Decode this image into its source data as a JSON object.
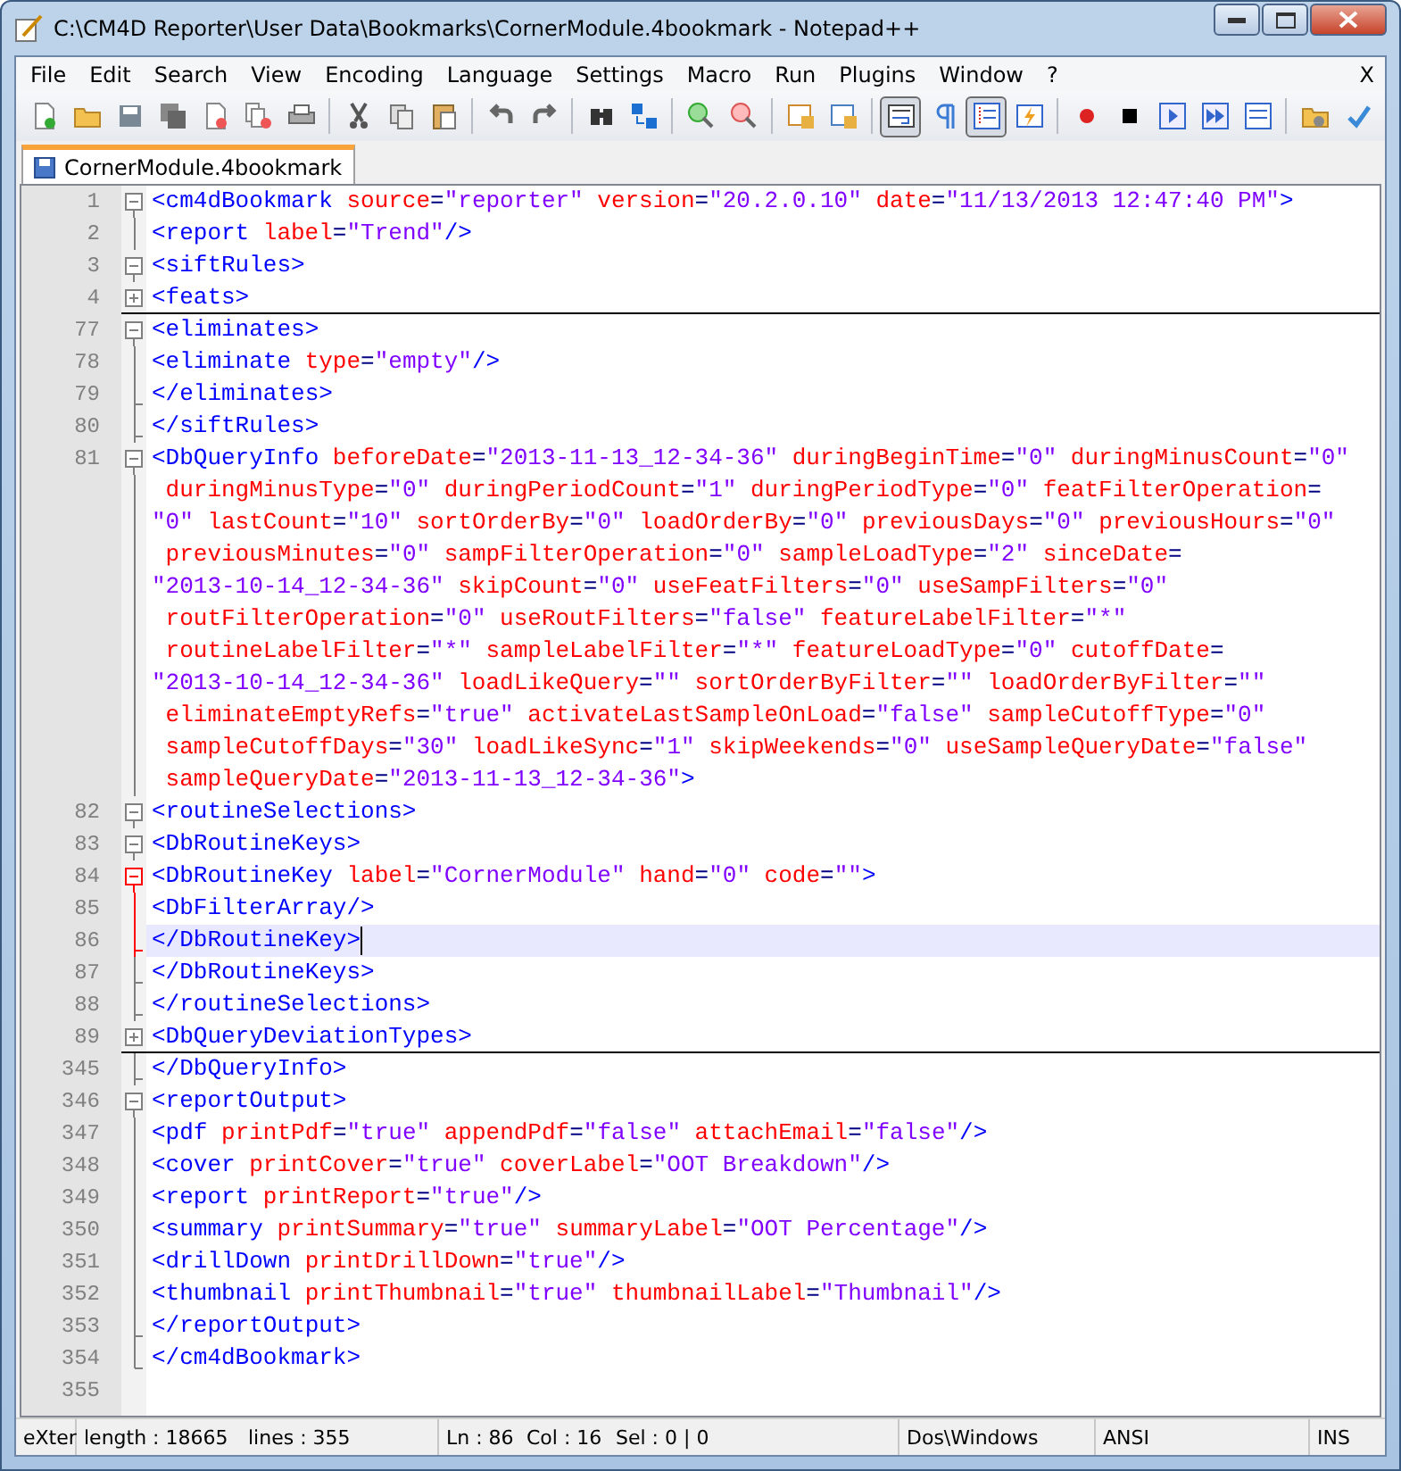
{
  "window": {
    "title": "C:\\CM4D Reporter\\User Data\\Bookmarks\\CornerModule.4bookmark - Notepad++"
  },
  "menu": [
    "File",
    "Edit",
    "Search",
    "View",
    "Encoding",
    "Language",
    "Settings",
    "Macro",
    "Run",
    "Plugins",
    "Window",
    "?"
  ],
  "menu_close": "X",
  "toolbar": {
    "view_toggles": [
      {
        "pressed": true
      },
      {
        "pressed": false
      },
      {
        "pressed": true
      },
      {
        "pressed": false
      }
    ]
  },
  "tabs": [
    {
      "label": "CornerModule.4bookmark",
      "selected": true
    }
  ],
  "lines": [
    {
      "number": "1",
      "kind": "start",
      "fold_active": false,
      "current": false,
      "rows": [
        {
          "tokens": [
            {
              "kind": "tag",
              "text": "<cm4dBookmark"
            },
            {
              "kind": "attr",
              "name": "source",
              "eq": "=",
              "value": "\"reporter\""
            },
            {
              "kind": "attr",
              "name": "version",
              "eq": "=",
              "value": "\"20.2.0.10\""
            },
            {
              "kind": "attr",
              "name": "date",
              "eq": "=",
              "value": "\"11/13/2013 12:47:40 PM\""
            },
            {
              "kind": "tag",
              "text": ">"
            }
          ]
        }
      ]
    },
    {
      "number": "2",
      "kind": "body",
      "fold_active": false,
      "current": false,
      "rows": [
        {
          "tokens": [
            {
              "kind": "tag",
              "text": "<report"
            },
            {
              "kind": "attr",
              "name": "label",
              "eq": "=",
              "value": "\"Trend\""
            },
            {
              "kind": "tag",
              "text": "/>"
            }
          ]
        }
      ]
    },
    {
      "number": "3",
      "kind": "start",
      "fold_active": false,
      "current": false,
      "rows": [
        {
          "tokens": [
            {
              "kind": "tag",
              "text": "<siftRules>"
            }
          ]
        }
      ]
    },
    {
      "number": "4",
      "kind": "folded",
      "fold_active": false,
      "current": false,
      "rows": [
        {
          "tokens": [
            {
              "kind": "tag",
              "text": "<feats>"
            }
          ]
        }
      ]
    },
    {
      "number": "77",
      "kind": "start",
      "fold_active": false,
      "current": false,
      "rows": [
        {
          "tokens": [
            {
              "kind": "tag",
              "text": "<eliminates>"
            }
          ]
        }
      ]
    },
    {
      "number": "78",
      "kind": "body",
      "fold_active": false,
      "current": false,
      "rows": [
        {
          "tokens": [
            {
              "kind": "tag",
              "text": "<eliminate"
            },
            {
              "kind": "attr",
              "name": "type",
              "eq": "=",
              "value": "\"empty\""
            },
            {
              "kind": "tag",
              "text": "/>"
            }
          ]
        }
      ]
    },
    {
      "number": "79",
      "kind": "end",
      "fold_active": false,
      "current": false,
      "rows": [
        {
          "tokens": [
            {
              "kind": "tag",
              "text": "</eliminates>"
            }
          ]
        }
      ]
    },
    {
      "number": "80",
      "kind": "end",
      "fold_active": false,
      "current": false,
      "rows": [
        {
          "tokens": [
            {
              "kind": "tag",
              "text": "</siftRules>"
            }
          ]
        }
      ]
    },
    {
      "number": "81",
      "kind": "start",
      "fold_active": false,
      "current": false,
      "rows": [
        {
          "tokens": [
            {
              "kind": "tag",
              "text": "<DbQueryInfo"
            },
            {
              "kind": "attr",
              "name": "beforeDate",
              "eq": "=",
              "value": "\"2013-11-13_12-34-36\""
            },
            {
              "kind": "attr",
              "name": "duringBeginTime",
              "eq": "=",
              "value": "\"0\""
            },
            {
              "kind": "attr",
              "name": "duringMinusCount",
              "eq": "=",
              "value": "\"0\""
            }
          ]
        },
        {
          "tokens": [
            {
              "kind": "attr",
              "name": "duringMinusType",
              "eq": "=",
              "value": "\"0\""
            },
            {
              "kind": "attr",
              "name": "duringPeriodCount",
              "eq": "=",
              "value": "\"1\""
            },
            {
              "kind": "attr",
              "name": "duringPeriodType",
              "eq": "=",
              "value": "\"0\""
            },
            {
              "kind": "attr",
              "name": "featFilterOperation",
              "eq": "="
            }
          ]
        },
        {
          "tokens": [
            {
              "kind": "value",
              "text": "\"0\""
            },
            {
              "kind": "attr",
              "name": "lastCount",
              "eq": "=",
              "value": "\"10\""
            },
            {
              "kind": "attr",
              "name": "sortOrderBy",
              "eq": "=",
              "value": "\"0\""
            },
            {
              "kind": "attr",
              "name": "loadOrderBy",
              "eq": "=",
              "value": "\"0\""
            },
            {
              "kind": "attr",
              "name": "previousDays",
              "eq": "=",
              "value": "\"0\""
            },
            {
              "kind": "attr",
              "name": "previousHours",
              "eq": "=",
              "value": "\"0\""
            }
          ]
        },
        {
          "tokens": [
            {
              "kind": "attr",
              "name": "previousMinutes",
              "eq": "=",
              "value": "\"0\""
            },
            {
              "kind": "attr",
              "name": "sampFilterOperation",
              "eq": "=",
              "value": "\"0\""
            },
            {
              "kind": "attr",
              "name": "sampleLoadType",
              "eq": "=",
              "value": "\"2\""
            },
            {
              "kind": "attr",
              "name": "sinceDate",
              "eq": "="
            }
          ]
        },
        {
          "tokens": [
            {
              "kind": "value",
              "text": "\"2013-10-14_12-34-36\""
            },
            {
              "kind": "attr",
              "name": "skipCount",
              "eq": "=",
              "value": "\"0\""
            },
            {
              "kind": "attr",
              "name": "useFeatFilters",
              "eq": "=",
              "value": "\"0\""
            },
            {
              "kind": "attr",
              "name": "useSampFilters",
              "eq": "=",
              "value": "\"0\""
            }
          ]
        },
        {
          "tokens": [
            {
              "kind": "attr",
              "name": "routFilterOperation",
              "eq": "=",
              "value": "\"0\""
            },
            {
              "kind": "attr",
              "name": "useRoutFilters",
              "eq": "=",
              "value": "\"false\""
            },
            {
              "kind": "attr",
              "name": "featureLabelFilter",
              "eq": "=",
              "value": "\"*\""
            }
          ]
        },
        {
          "tokens": [
            {
              "kind": "attr",
              "name": "routineLabelFilter",
              "eq": "=",
              "value": "\"*\""
            },
            {
              "kind": "attr",
              "name": "sampleLabelFilter",
              "eq": "=",
              "value": "\"*\""
            },
            {
              "kind": "attr",
              "name": "featureLoadType",
              "eq": "=",
              "value": "\"0\""
            },
            {
              "kind": "attr",
              "name": "cutoffDate",
              "eq": "="
            }
          ]
        },
        {
          "tokens": [
            {
              "kind": "value",
              "text": "\"2013-10-14_12-34-36\""
            },
            {
              "kind": "attr",
              "name": "loadLikeQuery",
              "eq": "=",
              "value": "\"\""
            },
            {
              "kind": "attr",
              "name": "sortOrderByFilter",
              "eq": "=",
              "value": "\"\""
            },
            {
              "kind": "attr",
              "name": "loadOrderByFilter",
              "eq": "=",
              "value": "\"\""
            }
          ]
        },
        {
          "tokens": [
            {
              "kind": "attr",
              "name": "eliminateEmptyRefs",
              "eq": "=",
              "value": "\"true\""
            },
            {
              "kind": "attr",
              "name": "activateLastSampleOnLoad",
              "eq": "=",
              "value": "\"false\""
            },
            {
              "kind": "attr",
              "name": "sampleCutoffType",
              "eq": "=",
              "value": "\"0\""
            }
          ]
        },
        {
          "tokens": [
            {
              "kind": "attr",
              "name": "sampleCutoffDays",
              "eq": "=",
              "value": "\"30\""
            },
            {
              "kind": "attr",
              "name": "loadLikeSync",
              "eq": "=",
              "value": "\"1\""
            },
            {
              "kind": "attr",
              "name": "skipWeekends",
              "eq": "=",
              "value": "\"0\""
            },
            {
              "kind": "attr",
              "name": "useSampleQueryDate",
              "eq": "=",
              "value": "\"false\""
            }
          ]
        },
        {
          "tokens": [
            {
              "kind": "attr",
              "name": "sampleQueryDate",
              "eq": "=",
              "value": "\"2013-11-13_12-34-36\""
            },
            {
              "kind": "tag",
              "text": ">"
            }
          ]
        }
      ]
    },
    {
      "number": "82",
      "kind": "start",
      "fold_active": false,
      "current": false,
      "rows": [
        {
          "tokens": [
            {
              "kind": "tag",
              "text": "<routineSelections>"
            }
          ]
        }
      ]
    },
    {
      "number": "83",
      "kind": "start",
      "fold_active": false,
      "current": false,
      "rows": [
        {
          "tokens": [
            {
              "kind": "tag",
              "text": "<DbRoutineKeys>"
            }
          ]
        }
      ]
    },
    {
      "number": "84",
      "kind": "start",
      "fold_active": true,
      "current": false,
      "rows": [
        {
          "tokens": [
            {
              "kind": "tag",
              "text": "<DbRoutineKey"
            },
            {
              "kind": "attr",
              "name": "label",
              "eq": "=",
              "value": "\"CornerModule\""
            },
            {
              "kind": "attr",
              "name": "hand",
              "eq": "=",
              "value": "\"0\""
            },
            {
              "kind": "attr",
              "name": "code",
              "eq": "=",
              "value": "\"\""
            },
            {
              "kind": "tag",
              "text": ">"
            }
          ]
        }
      ]
    },
    {
      "number": "85",
      "kind": "body",
      "fold_active": true,
      "current": false,
      "rows": [
        {
          "tokens": [
            {
              "kind": "tag",
              "text": "<DbFilterArray/>"
            }
          ]
        }
      ]
    },
    {
      "number": "86",
      "kind": "end",
      "fold_active": true,
      "current": true,
      "rows": [
        {
          "tokens": [
            {
              "kind": "tag",
              "text": "</DbRoutineKey>"
            }
          ]
        }
      ]
    },
    {
      "number": "87",
      "kind": "end",
      "fold_active": false,
      "current": false,
      "rows": [
        {
          "tokens": [
            {
              "kind": "tag",
              "text": "</DbRoutineKeys>"
            }
          ]
        }
      ]
    },
    {
      "number": "88",
      "kind": "end",
      "fold_active": false,
      "current": false,
      "rows": [
        {
          "tokens": [
            {
              "kind": "tag",
              "text": "</routineSelections>"
            }
          ]
        }
      ]
    },
    {
      "number": "89",
      "kind": "folded",
      "fold_active": false,
      "current": false,
      "rows": [
        {
          "tokens": [
            {
              "kind": "tag",
              "text": "<DbQueryDeviationTypes>"
            }
          ]
        }
      ]
    },
    {
      "number": "345",
      "kind": "end",
      "fold_active": false,
      "current": false,
      "rows": [
        {
          "tokens": [
            {
              "kind": "tag",
              "text": "</DbQueryInfo>"
            }
          ]
        }
      ]
    },
    {
      "number": "346",
      "kind": "start",
      "fold_active": false,
      "current": false,
      "rows": [
        {
          "tokens": [
            {
              "kind": "tag",
              "text": "<reportOutput>"
            }
          ]
        }
      ]
    },
    {
      "number": "347",
      "kind": "body",
      "fold_active": false,
      "current": false,
      "rows": [
        {
          "tokens": [
            {
              "kind": "tag",
              "text": "<pdf"
            },
            {
              "kind": "attr",
              "name": "printPdf",
              "eq": "=",
              "value": "\"true\""
            },
            {
              "kind": "attr",
              "name": "appendPdf",
              "eq": "=",
              "value": "\"false\""
            },
            {
              "kind": "attr",
              "name": "attachEmail",
              "eq": "=",
              "value": "\"false\""
            },
            {
              "kind": "tag",
              "text": "/>"
            }
          ]
        }
      ]
    },
    {
      "number": "348",
      "kind": "body",
      "fold_active": false,
      "current": false,
      "rows": [
        {
          "tokens": [
            {
              "kind": "tag",
              "text": "<cover"
            },
            {
              "kind": "attr",
              "name": "printCover",
              "eq": "=",
              "value": "\"true\""
            },
            {
              "kind": "attr",
              "name": "coverLabel",
              "eq": "=",
              "value": "\"OOT Breakdown\""
            },
            {
              "kind": "tag",
              "text": "/>"
            }
          ]
        }
      ]
    },
    {
      "number": "349",
      "kind": "body",
      "fold_active": false,
      "current": false,
      "rows": [
        {
          "tokens": [
            {
              "kind": "tag",
              "text": "<report"
            },
            {
              "kind": "attr",
              "name": "printReport",
              "eq": "=",
              "value": "\"true\""
            },
            {
              "kind": "tag",
              "text": "/>"
            }
          ]
        }
      ]
    },
    {
      "number": "350",
      "kind": "body",
      "fold_active": false,
      "current": false,
      "rows": [
        {
          "tokens": [
            {
              "kind": "tag",
              "text": "<summary"
            },
            {
              "kind": "attr",
              "name": "printSummary",
              "eq": "=",
              "value": "\"true\""
            },
            {
              "kind": "attr",
              "name": "summaryLabel",
              "eq": "=",
              "value": "\"OOT Percentage\""
            },
            {
              "kind": "tag",
              "text": "/>"
            }
          ]
        }
      ]
    },
    {
      "number": "351",
      "kind": "body",
      "fold_active": false,
      "current": false,
      "rows": [
        {
          "tokens": [
            {
              "kind": "tag",
              "text": "<drillDown"
            },
            {
              "kind": "attr",
              "name": "printDrillDown",
              "eq": "=",
              "value": "\"true\""
            },
            {
              "kind": "tag",
              "text": "/>"
            }
          ]
        }
      ]
    },
    {
      "number": "352",
      "kind": "body",
      "fold_active": false,
      "current": false,
      "rows": [
        {
          "tokens": [
            {
              "kind": "tag",
              "text": "<thumbnail"
            },
            {
              "kind": "attr",
              "name": "printThumbnail",
              "eq": "=",
              "value": "\"true\""
            },
            {
              "kind": "attr",
              "name": "thumbnailLabel",
              "eq": "=",
              "value": "\"Thumbnail\""
            },
            {
              "kind": "tag",
              "text": "/>"
            }
          ]
        }
      ]
    },
    {
      "number": "353",
      "kind": "end",
      "fold_active": false,
      "current": false,
      "rows": [
        {
          "tokens": [
            {
              "kind": "tag",
              "text": "</reportOutput>"
            }
          ]
        }
      ]
    },
    {
      "number": "354",
      "kind": "last",
      "fold_active": false,
      "current": false,
      "rows": [
        {
          "tokens": [
            {
              "kind": "tag",
              "text": "</cm4dBookmark>"
            }
          ]
        }
      ]
    },
    {
      "number": "355",
      "kind": "plain",
      "current": false
    }
  ],
  "status_bar": [
    "eXter",
    "length : 18665",
    "lines : 355",
    "Ln : 86",
    "Col : 16",
    "Sel : 0 | 0",
    "Dos\\Windows",
    "ANSI",
    "INS"
  ]
}
